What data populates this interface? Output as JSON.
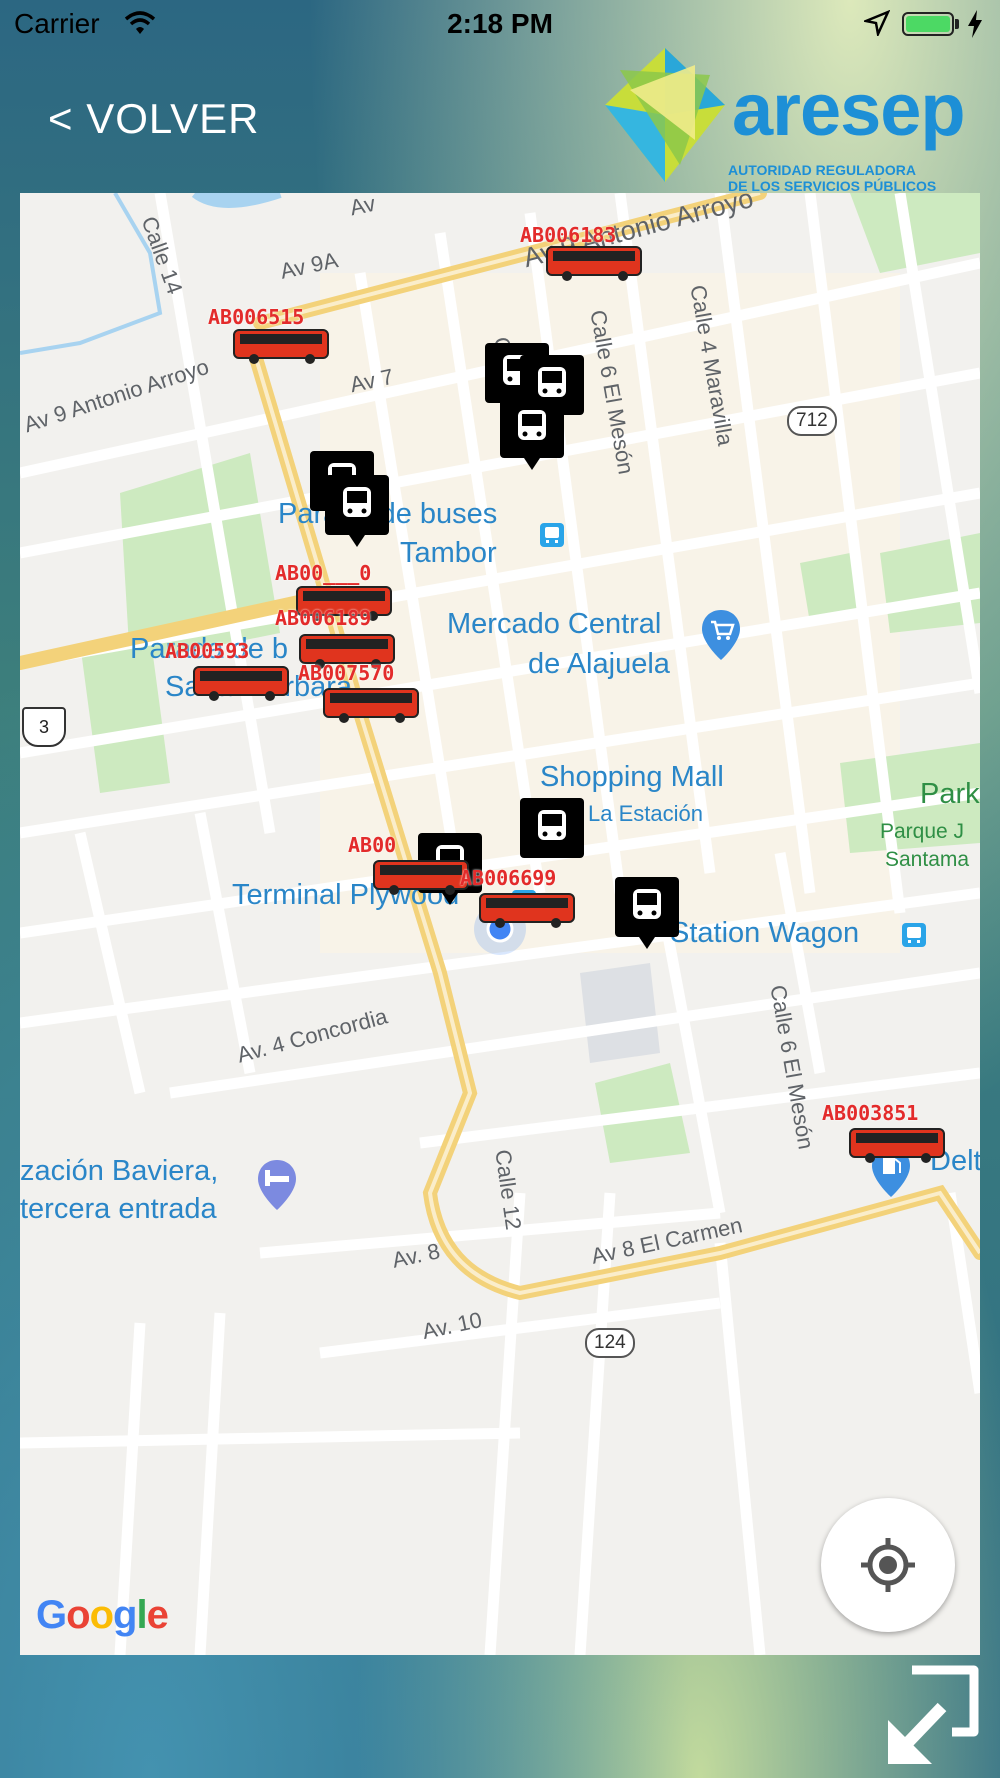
{
  "status_bar": {
    "carrier": "Carrier",
    "time": "2:18 PM",
    "wifi_icon": "wifi-icon",
    "location_icon": "location-arrow-icon",
    "battery_icon": "battery-icon",
    "charging_icon": "charging-bolt-icon"
  },
  "header": {
    "back_label": "< VOLVER",
    "logo": {
      "word": "aresep",
      "subtitle_line1": "AUTORIDAD REGULADORA",
      "subtitle_line2": "DE LOS SERVICIOS PÚBLICOS",
      "color": "#1d8fd6"
    }
  },
  "map": {
    "streets": {
      "av_9_antonio_arroyo": "Av 9 Antonio Arroyo",
      "av_9a": "Av 9A",
      "av_7": "Av 7",
      "calle_14": "Calle 14",
      "antonio_arroyo": "Av 9 Antonio Arroyo",
      "calle_6_el_meson_top": "Calle 6 El Mesón",
      "calle_4_maravilla": "Calle 4 Maravilla",
      "av_4_concordia": "Av. 4 Concordia",
      "calle_12": "Calle 12",
      "av_8_el_carmen": "Av 8 El Carmen",
      "calle_6_el_meson_bottom": "Calle 6 El Mesón",
      "av_8": "Av. 8",
      "av_10": "Av. 10",
      "calle_top_partial": "Call",
      "av_top_partial": "Av"
    },
    "route_shields": {
      "r712": "712",
      "r124": "124",
      "us3": "3"
    },
    "places": {
      "parada_tambor_1": "Parada de buses",
      "parada_tambor_2": "Tambor",
      "mercado_1": "Mercado Central",
      "mercado_2": "de Alajuela",
      "parada_sb_1": "Parada de b",
      "parada_sb_2": "Santa Bárbara",
      "shopping_1": "Shopping Mall",
      "shopping_2": "La Estación",
      "terminal": "Terminal Plywood",
      "station_wagon": "Station Wagon",
      "park_1": "Park",
      "park_2": "Parque J",
      "park_3": "Santama",
      "baviera_1": "zación Baviera,",
      "baviera_2": "tercera entrada",
      "delta": "Delt"
    },
    "buses": [
      {
        "id": "AB006183"
      },
      {
        "id": "AB006515"
      },
      {
        "id": "AB00___0"
      },
      {
        "id": "AB006189"
      },
      {
        "id": "AB00593"
      },
      {
        "id": "AB007570"
      },
      {
        "id": "AB00"
      },
      {
        "id": "AB006699"
      },
      {
        "id": "AB003851"
      }
    ],
    "bus_color": "#e32b2b",
    "stop_marker_icon": "bus-stop-marker-icon",
    "google_logo": "Google"
  },
  "controls": {
    "my_location_icon": "my-location-icon",
    "expand_icon": "expand-arrow-icon"
  }
}
